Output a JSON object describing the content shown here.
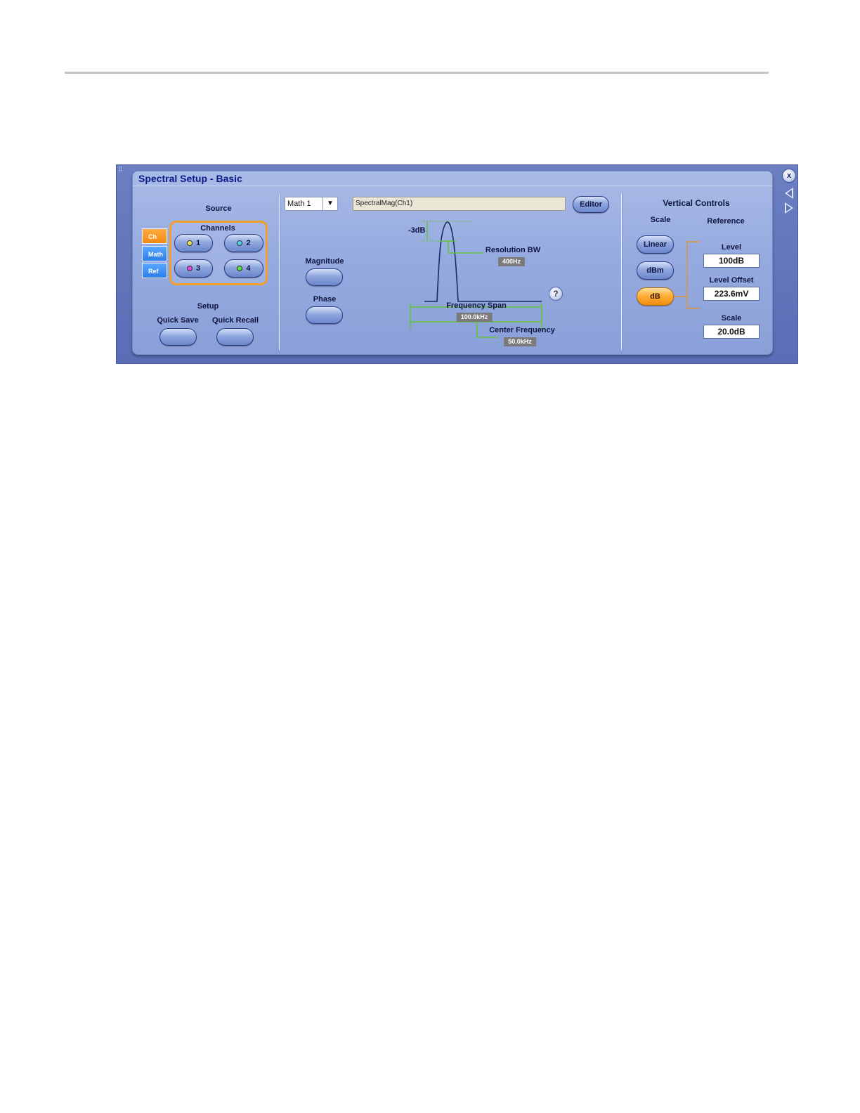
{
  "panel": {
    "title": "Spectral Setup - Basic",
    "close_label": "x"
  },
  "source": {
    "heading": "Source",
    "tabs": [
      {
        "label": "Ch",
        "active": true
      },
      {
        "label": "Math",
        "active": false
      },
      {
        "label": "Ref",
        "active": false
      }
    ],
    "channels_heading": "Channels",
    "channels": [
      {
        "label": "1",
        "dot_color": "#f2e44a"
      },
      {
        "label": "2",
        "dot_color": "#4ad4f2"
      },
      {
        "label": "3",
        "dot_color": "#e64ad8"
      },
      {
        "label": "4",
        "dot_color": "#58e23a"
      }
    ],
    "accent_color": "#f3a02a"
  },
  "setup": {
    "heading": "Setup",
    "quick_save": "Quick Save",
    "quick_recall": "Quick Recall"
  },
  "math": {
    "select_value": "Math 1",
    "select_arrow": "▼",
    "expression": "SpectralMag(Ch1)",
    "editor_button": "Editor",
    "magnitude_label": "Magnitude",
    "phase_label": "Phase"
  },
  "diagram": {
    "minus3db_label": "-3dB",
    "resolution_bw_label": "Resolution BW",
    "resolution_bw_value": "400Hz",
    "frequency_span_label": "Frequency Span",
    "frequency_span_value": "100.0kHz",
    "center_frequency_label": "Center Frequency",
    "center_frequency_value": "50.0kHz",
    "help_symbol": "?"
  },
  "vertical": {
    "heading": "Vertical Controls",
    "scale_heading": "Scale",
    "reference_heading": "Reference",
    "scale_buttons": [
      {
        "label": "Linear",
        "active": false
      },
      {
        "label": "dBm",
        "active": false
      },
      {
        "label": "dB",
        "active": true
      }
    ],
    "level_label": "Level",
    "level_value": "100dB",
    "level_offset_label": "Level Offset",
    "level_offset_value": "223.6mV",
    "scale_label": "Scale",
    "scale_value": "20.0dB"
  }
}
